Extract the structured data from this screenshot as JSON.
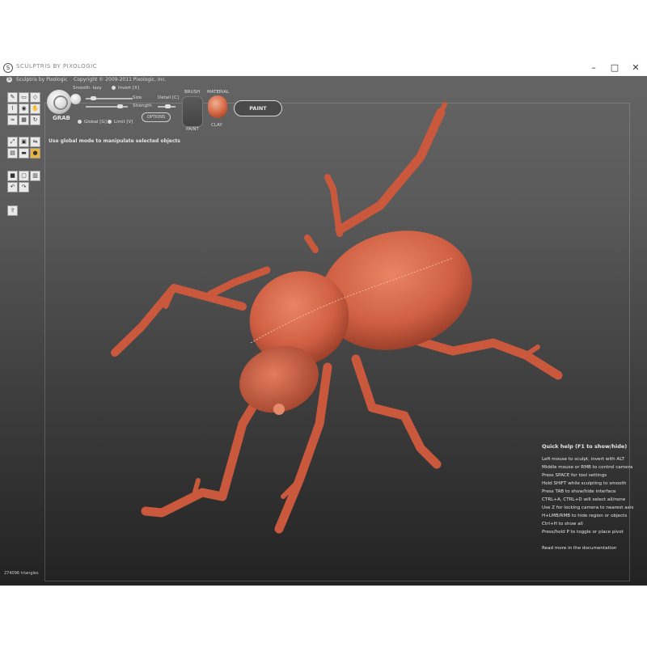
{
  "window": {
    "title": "SCULPTRIS BY PIXOLOGIC",
    "app_icon": "S",
    "minimize": "–",
    "maximize": "□",
    "close": "✕"
  },
  "topbar": {
    "app_name": "Sculptris by Pixologic",
    "copyright": "Copyright © 2009-2011 Pixologic, Inc."
  },
  "brush": {
    "name": "GRAB",
    "size_label": "Size",
    "strength_label": "Strength",
    "detail_label": "Detail [C]",
    "invert_label": "Invert [X]",
    "smooth_label": "Smooth ·lazy",
    "global_label": "Global [G]",
    "limit_label": "Limit [V]",
    "options_label": "OPTIONS",
    "brush_caption": "BRUSH",
    "material_caption": "MATERIAL",
    "brush_sub": "PAINT",
    "material_sub": "CLAY",
    "paint_button": "PAINT"
  },
  "tools": [
    {
      "icon": "draw-tool-icon",
      "glyph": "✎"
    },
    {
      "icon": "flatten-tool-icon",
      "glyph": "▭"
    },
    {
      "icon": "pinch-tool-icon",
      "glyph": "◇"
    },
    {
      "icon": "crease-tool-icon",
      "glyph": "⌇"
    },
    {
      "icon": "inflate-tool-icon",
      "glyph": "◉"
    },
    {
      "icon": "grab-tool-icon",
      "glyph": "✋"
    },
    {
      "icon": "smooth-tool-icon",
      "glyph": "≈"
    },
    {
      "icon": "reduce-tool-icon",
      "glyph": "▦"
    },
    {
      "icon": "rotate-tool-icon",
      "glyph": "↻"
    },
    {
      "icon": "scale-tool-icon",
      "glyph": "⤢"
    },
    {
      "icon": "mask-tool-icon",
      "glyph": "▣"
    },
    {
      "icon": "symmetry-tool-icon",
      "glyph": "⇋"
    },
    {
      "icon": "wireframe-tool-icon",
      "glyph": "▤"
    },
    {
      "icon": "plane-tool-icon",
      "glyph": "▬"
    },
    {
      "icon": "new-sphere-icon",
      "glyph": "●"
    },
    {
      "icon": "new-plane-icon",
      "glyph": "■"
    },
    {
      "icon": "open-file-icon",
      "glyph": "▢"
    },
    {
      "icon": "save-file-icon",
      "glyph": "▥"
    },
    {
      "icon": "undo-icon",
      "glyph": "↶"
    },
    {
      "icon": "redo-icon",
      "glyph": "↷"
    },
    {
      "icon": "export-icon",
      "glyph": "⇪"
    }
  ],
  "mode_hint": "Use global mode to manipulate selected objects",
  "help": {
    "title": "Quick help (F1 to show/hide)",
    "lines": [
      "Left mouse to sculpt, invert with ALT",
      "Middle mouse or RMB to control camera",
      "Press SPACE for tool settings",
      "Hold SHIFT while sculpting to smooth",
      "Press TAB to show/hide interface",
      "CTRL+A, CTRL+D will select all/none",
      "Use Z for locking camera to nearest axis",
      "H+LMB/RMB to hide region or objects",
      "Ctrl+H to show all",
      "Press/hold P to toggle or place pivot"
    ],
    "more": "Read more in the documentation"
  },
  "status": {
    "triangles": "274096 triangles"
  },
  "colors": {
    "model": "#d4654a",
    "active_tool": "#e8b540"
  }
}
